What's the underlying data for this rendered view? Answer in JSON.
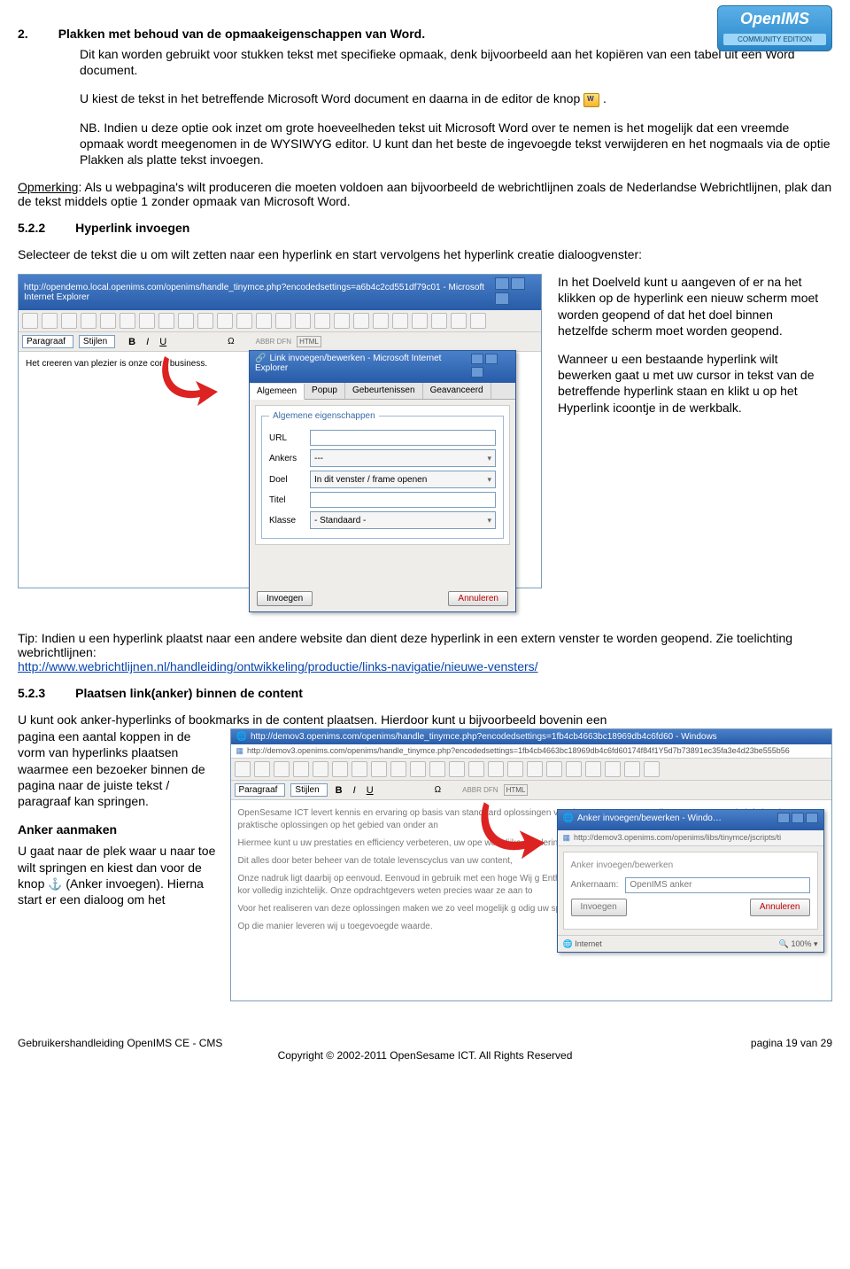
{
  "logo": {
    "brand": "OpenIMS",
    "sub": "COMMUNITY EDITION"
  },
  "item2": {
    "num": "2.",
    "title": "Plakken met behoud van de opmaakeigenschappen van Word.",
    "p1": "Dit kan worden gebruikt voor stukken tekst met specifieke opmaak, denk bijvoorbeeld aan het kopiëren van een tabel uit een Word document.",
    "p2_a": "U kiest de tekst in het betreffende Microsoft Word document en daarna in de editor de knop ",
    "p2_b": ".",
    "nb": "NB. Indien u deze optie ook inzet om grote hoeveelheden tekst uit Microsoft Word over te nemen is het mogelijk dat een vreemde opmaak wordt meegenomen in de WYSIWYG editor. U kunt dan het beste de ingevoegde tekst verwijderen en het nogmaals via de optie Plakken als platte tekst invoegen."
  },
  "opmerking_label": "Opmerking",
  "opmerking": ": Als u webpagina's wilt produceren die moeten voldoen aan bijvoorbeeld de webrichtlijnen zoals de Nederlandse Webrichtlijnen, plak dan de tekst middels optie 1 zonder opmaak van Microsoft Word.",
  "s522": {
    "num": "5.2.2",
    "title": "Hyperlink invoegen"
  },
  "s522_intro": "Selecteer de tekst die u om wilt zetten naar een hyperlink en start vervolgens het hyperlink creatie dialoogvenster:",
  "ss1": {
    "title": "http://opendemo.local.openims.com/openims/handle_tinymce.php?encodedsettings=a6b4c2cd551df79c01 - Microsoft Internet Explorer",
    "format_paragraaf": "Paragraaf",
    "format_stijlen": "Stijlen",
    "bodytext": "Het creeren van plezier is onze core business.",
    "dlg_title": "Link invoegen/bewerken - Microsoft Internet Explorer",
    "tabs": {
      "t1": "Algemeen",
      "t2": "Popup",
      "t3": "Gebeurtenissen",
      "t4": "Geavanceerd"
    },
    "legend": "Algemene eigenschappen",
    "lbl_url": "URL",
    "val_url": "",
    "lbl_ankers": "Ankers",
    "val_ankers": "---",
    "lbl_doel": "Doel",
    "val_doel": "In dit venster / frame openen",
    "lbl_titel": "Titel",
    "val_titel": "",
    "lbl_klasse": "Klasse",
    "val_klasse": "- Standaard -",
    "btn_invoegen": "Invoegen",
    "btn_annuleren": "Annuleren"
  },
  "right1": {
    "p1": "In het Doelveld kunt u aangeven of er na het klikken op de hyperlink een nieuw scherm moet worden geopend of dat het doel binnen hetzelfde scherm moet worden geopend.",
    "p2": "Wanneer u een bestaande hyperlink wilt bewerken gaat u met uw cursor in tekst van de betreffende hyperlink staan en klikt u op het Hyperlink icoontje in de werkbalk."
  },
  "tip_a": "Tip: Indien u een hyperlink plaatst naar een andere website dan dient deze hyperlink in een extern venster te worden geopend. Zie toelichting webrichtlijnen:",
  "tip_link": "http://www.webrichtlijnen.nl/handleiding/ontwikkeling/productie/links-navigatie/nieuwe-vensters/",
  "s523": {
    "num": "5.2.3",
    "title": "Plaatsen link(anker) binnen de content"
  },
  "s523_intro": "U kunt ook anker-hyperlinks of bookmarks in de content plaatsen. Hierdoor kunt u bijvoorbeeld bovenin een",
  "left2": {
    "p1": "pagina een aantal koppen in de vorm van hyperlinks plaatsen waarmee een bezoeker binnen de pagina naar de juiste tekst / paragraaf kan springen.",
    "h": "Anker aanmaken",
    "p2_a": "U gaat naar de plek waar u naar toe wilt springen en kiest dan voor de knop ",
    "p2_b": " (Anker invoegen). Hierna start er een dialoog om het"
  },
  "ss2": {
    "title": "http://demov3.openims.com/openims/handle_tinymce.php?encodedsettings=1fb4cb4663bc18969db4c6fd60 - Windows",
    "addr": "http://demov3.openims.com/openims/handle_tinymce.php?encodedsettings=1fb4cb4663bc18969db4c6fd60174f84f1Y5d7b73891ec35fa3e4d23be555b56",
    "format_paragraaf": "Paragraaf",
    "format_stijlen": "Stijlen",
    "body_p1": "OpenSesame ICT levert kennis en ervaring op basis van standaard oplossingen voor het structureren van alle ongestructureerde info betekent praktische oplossingen op het gebied van onder an",
    "body_p2": "Hiermee kunt u uw prestaties en efficiency verbeteren, uw ope wettelijke reguleringen zoals de archiefwet en webrichtlijnen.",
    "body_p3": "Dit alles door beter beheer van de totale levenscyclus van uw content,",
    "body_p4": "Onze nadruk ligt daarbij op eenvoud. Eenvoud in gebruik met een hoge    Wij g Enthousiast en gemotiveerd werken wij naar een succesvol eindresulta    kor volledig inzichtelijk. Onze opdrachtgevers weten precies waar ze aan to",
    "body_p5": "Voor het realiseren van deze oplossingen maken we zo veel mogelijk g    odig uw specifieke situatie. Hierdoor kunnen oplossingen snel geïmplemente",
    "body_p6": "Op die manier leveren wij u toegevoegde waarde.",
    "dlg_title": "Anker invoegen/bewerken - Windo…",
    "dlg_addr": "http://demov3.openims.com/openims/libs/tinymce/jscripts/ti",
    "grp_title": "Anker invoegen/bewerken",
    "lbl_ankernaam": "Ankernaam:",
    "val_ankernaam": "OpenIMS anker",
    "btn_invoegen": "Invoegen",
    "btn_annuleren": "Annuleren",
    "status_net": "Internet",
    "status_zoom": "100%"
  },
  "footer": {
    "left": "Gebruikershandleiding OpenIMS CE - CMS",
    "right": "pagina 19 van 29",
    "center": "Copyright © 2002-2011 OpenSesame ICT. All Rights Reserved"
  }
}
